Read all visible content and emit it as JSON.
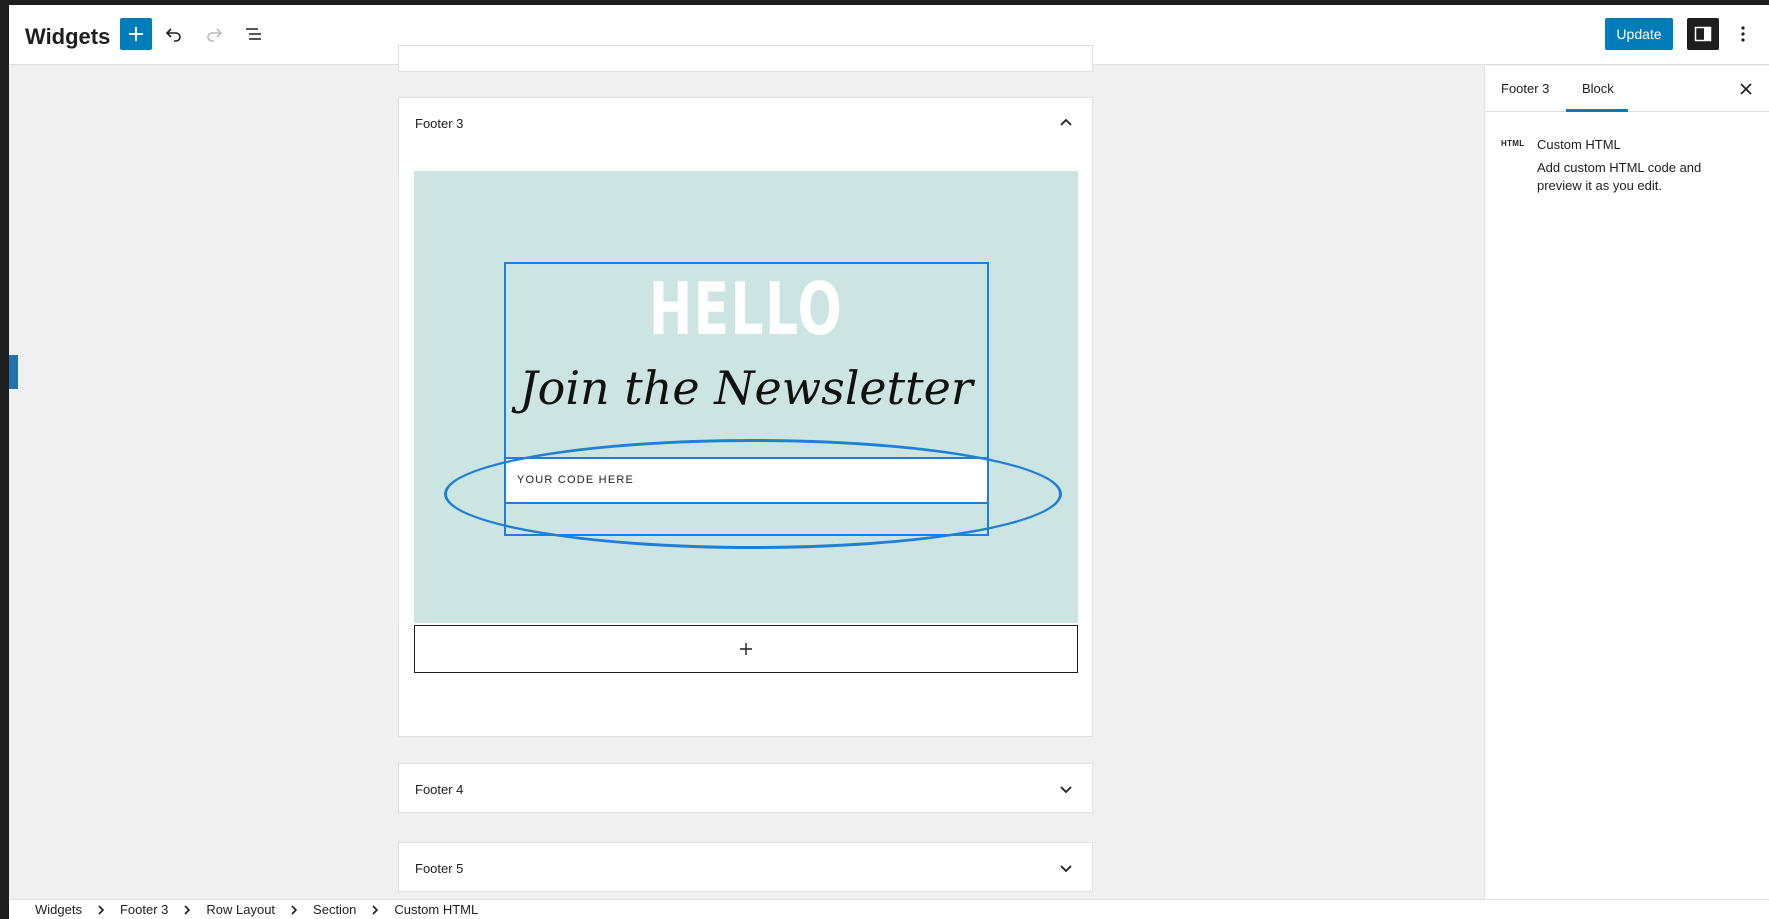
{
  "header": {
    "title": "Widgets",
    "update_label": "Update"
  },
  "canvas": {
    "areas": [
      {
        "label": ""
      },
      {
        "label": "Footer 3",
        "expanded": true
      },
      {
        "label": "Footer 4",
        "expanded": false
      },
      {
        "label": "Footer 5",
        "expanded": false
      },
      {
        "label": ""
      }
    ],
    "newsletter": {
      "hello": "HELLO",
      "join": "Join the Newsletter",
      "code_placeholder": "YOUR CODE HERE",
      "background": "#cce5e3"
    }
  },
  "sidebar": {
    "tabs": [
      {
        "label": "Footer 3",
        "active": false
      },
      {
        "label": "Block",
        "active": true
      }
    ],
    "block": {
      "icon_label": "HTML",
      "name": "Custom HTML",
      "description": "Add custom HTML code and preview it as you edit."
    }
  },
  "breadcrumb": [
    "Widgets",
    "Footer 3",
    "Row Layout",
    "Section",
    "Custom HTML"
  ],
  "colors": {
    "accent": "#007cba",
    "selection": "#1e7fd8",
    "dark": "#1e1e1e"
  },
  "icons": {
    "add": "plus-icon",
    "undo": "undo-icon",
    "redo": "redo-icon",
    "list_view": "list-view-icon",
    "settings": "sidebar-settings-icon",
    "options": "more-vertical-icon",
    "close": "close-icon"
  }
}
